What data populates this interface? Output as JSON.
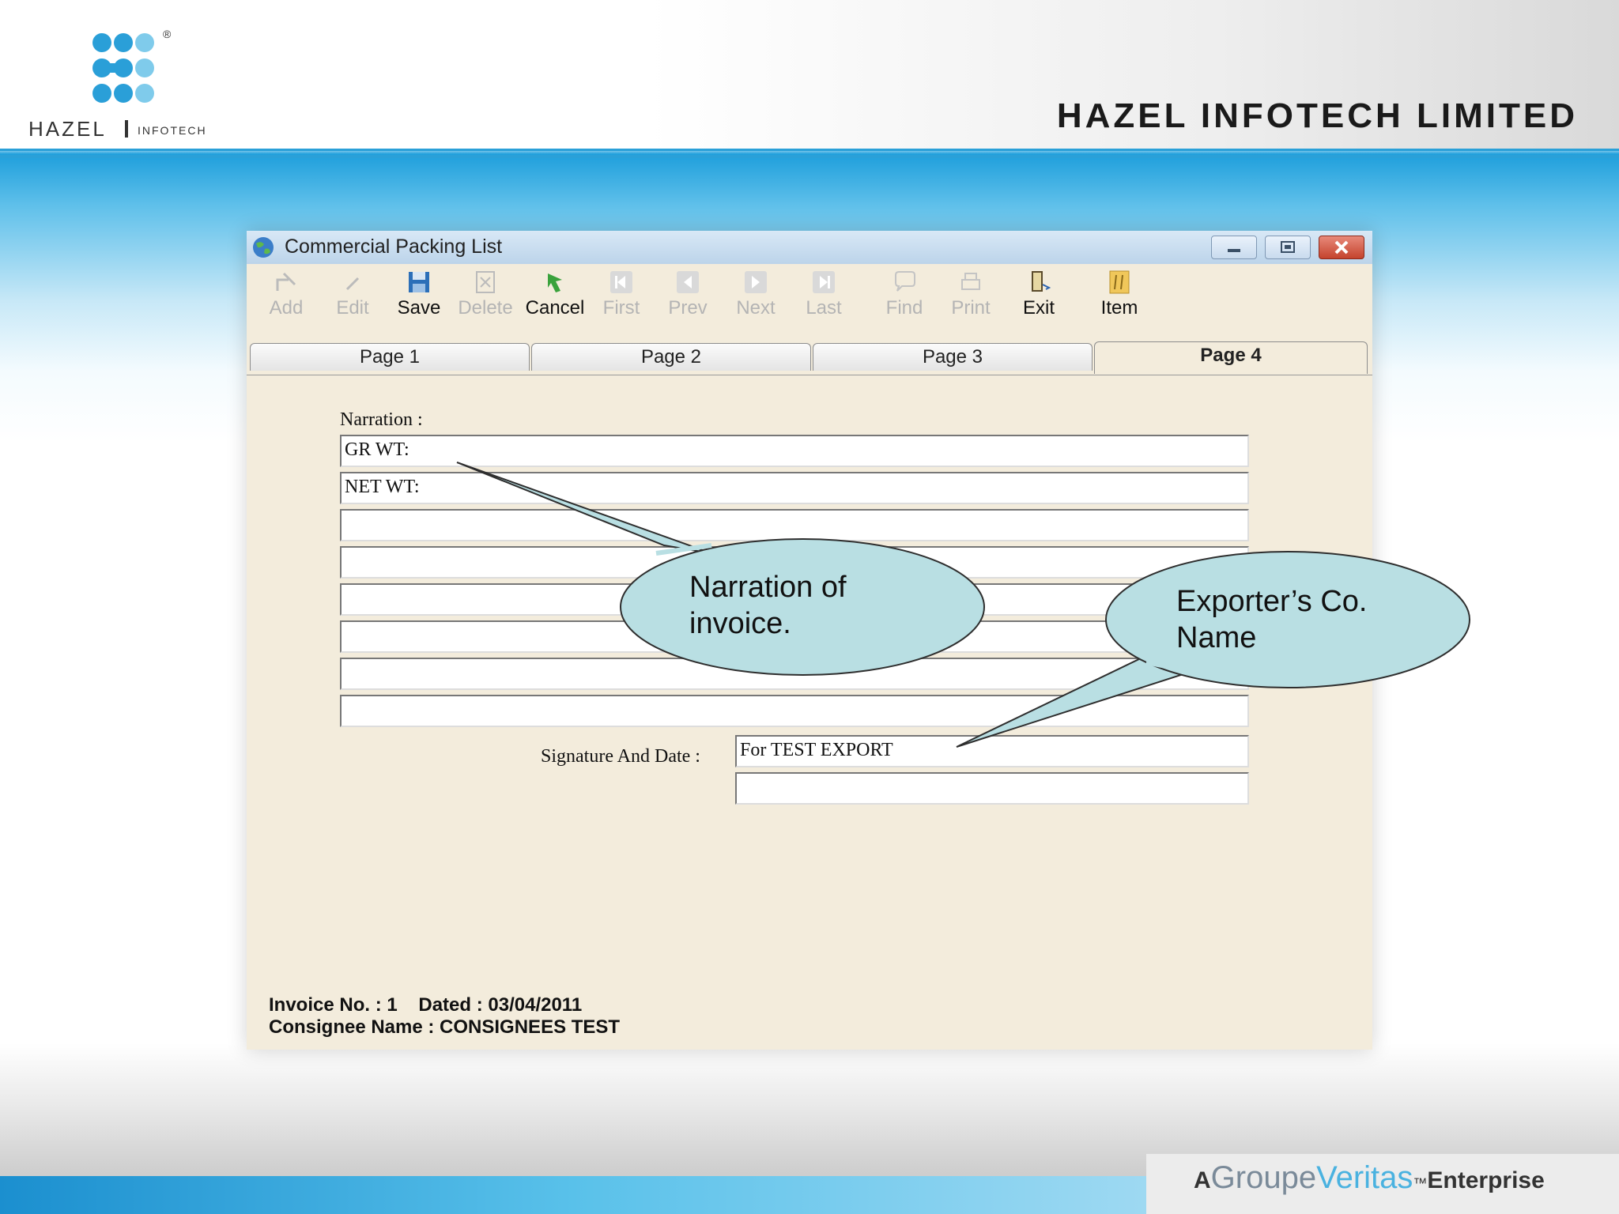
{
  "header": {
    "company_title": "HAZEL INFOTECH LIMITED",
    "logo_text": "HAZEL | INFOTECH",
    "logo_mark": "®"
  },
  "window": {
    "title": "Commercial Packing List",
    "app_icon": "globe-icon",
    "controls": [
      "minimize",
      "maximize",
      "close"
    ]
  },
  "toolbar": {
    "add": "Add",
    "edit": "Edit",
    "save": "Save",
    "delete": "Delete",
    "cancel": "Cancel",
    "first": "First",
    "prev": "Prev",
    "next": "Next",
    "last": "Last",
    "find": "Find",
    "print": "Print",
    "exit": "Exit",
    "item": "Item"
  },
  "tabs": [
    "Page 1",
    "Page 2",
    "Page 3",
    "Page 4"
  ],
  "active_tab": "Page 4",
  "form": {
    "narration_label": "Narration :",
    "narration_lines": [
      "GR WT:",
      "NET WT:",
      "",
      "",
      "",
      "",
      "",
      ""
    ],
    "signature_label": "Signature And Date :",
    "signature_lines": [
      "For TEST EXPORT",
      ""
    ]
  },
  "status": {
    "invoice_line": "Invoice No. : 1    Dated : 03/04/2011",
    "consignee_line": "Consignee Name : CONSIGNEES TEST"
  },
  "callouts": {
    "narration": [
      "Narration of",
      "invoice."
    ],
    "exporter": [
      "Exporter’s Co.",
      "Name"
    ]
  },
  "footer": {
    "prefix": "A",
    "groupe": "Groupe",
    "veritas": "Veritas",
    "tm": "™",
    "enterprise": "Enterprise"
  },
  "colors": {
    "accent_blue": "#2aa0d8",
    "window_bg": "#f3ecdc",
    "callout_fill": "#b9dfe3",
    "toolbar_disabled": "#b4b4b4"
  }
}
